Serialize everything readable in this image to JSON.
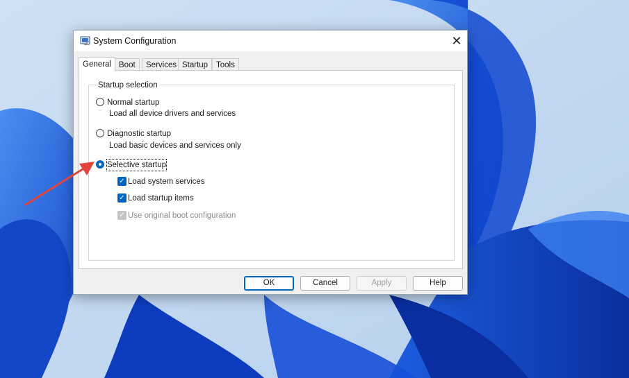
{
  "window": {
    "title": "System Configuration",
    "icon": "msconfig-icon",
    "close_icon": "close-icon"
  },
  "tabs": [
    {
      "label": "General",
      "active": true
    },
    {
      "label": "Boot",
      "active": false
    },
    {
      "label": "Services",
      "active": false
    },
    {
      "label": "Startup",
      "active": false
    },
    {
      "label": "Tools",
      "active": false
    }
  ],
  "general": {
    "group_label": "Startup selection",
    "normal": {
      "label": "Normal startup",
      "desc": "Load all device drivers and services",
      "checked": false
    },
    "diagnostic": {
      "label": "Diagnostic startup",
      "desc": "Load basic devices and services only",
      "checked": false
    },
    "selective": {
      "label": "Selective startup",
      "checked": true
    },
    "options": [
      {
        "label": "Load system services",
        "checked": true,
        "enabled": true
      },
      {
        "label": "Load startup items",
        "checked": true,
        "enabled": true
      },
      {
        "label": "Use original boot configuration",
        "checked": true,
        "enabled": false
      }
    ]
  },
  "buttons": {
    "ok": "OK",
    "cancel": "Cancel",
    "apply": "Apply",
    "help": "Help"
  },
  "colors": {
    "accent": "#0067c0",
    "annotation_arrow": "#e0443a"
  }
}
